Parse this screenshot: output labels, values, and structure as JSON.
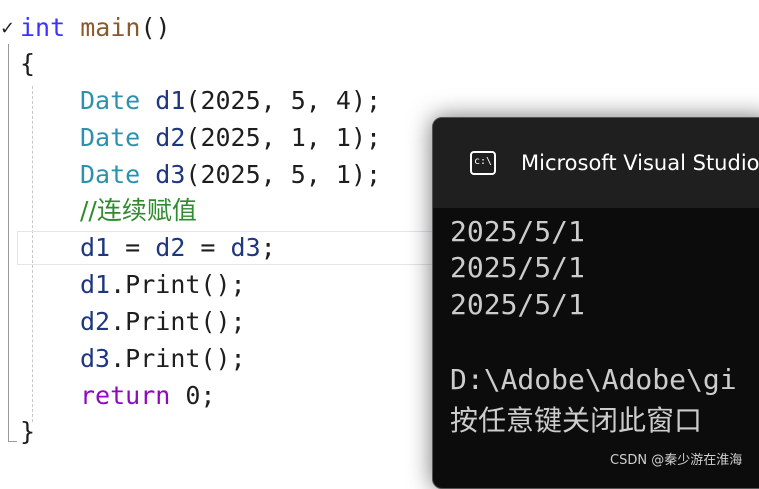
{
  "editor": {
    "fold_glyph": "✓",
    "code": {
      "l0": {
        "kw": "int",
        "fn": "main",
        "rest": "()"
      },
      "l1": {
        "text": "{"
      },
      "l2": {
        "type": "Date",
        "var": "d1",
        "args": "(2025, 5, 4);"
      },
      "l3": {
        "type": "Date",
        "var": "d2",
        "args": "(2025, 1, 1);"
      },
      "l4": {
        "type": "Date",
        "var": "d3",
        "args": "(2025, 5, 1);"
      },
      "l5": {
        "comment": "//连续赋值"
      },
      "l6": {
        "v1": "d1",
        "op1": " = ",
        "v2": "d2",
        "op2": " = ",
        "v3": "d3",
        "end": ";"
      },
      "l7": {
        "var": "d1",
        "call": ".Print();"
      },
      "l8": {
        "var": "d2",
        "call": ".Print();"
      },
      "l9": {
        "var": "d3",
        "call": ".Print();"
      },
      "l10": {
        "kw": "return",
        "rest": " 0;"
      },
      "l11": {
        "text": "}"
      }
    }
  },
  "console": {
    "title": "Microsoft Visual Studio",
    "icon_label": "c:\\",
    "output": [
      "2025/5/1",
      "2025/5/1",
      "2025/5/1"
    ],
    "path": "D:\\Adobe\\Adobe\\gi",
    "prompt": "按任意键关闭此窗口"
  },
  "watermark": "CSDN @秦少游在淮海",
  "colors": {
    "keyword": "#3b33ff",
    "type": "#2b91af",
    "variable": "#1f377f",
    "comment": "#2e8b2e",
    "return_kw": "#8f08c4",
    "console_bg": "#0c0c0c",
    "console_text": "#cccccc"
  }
}
